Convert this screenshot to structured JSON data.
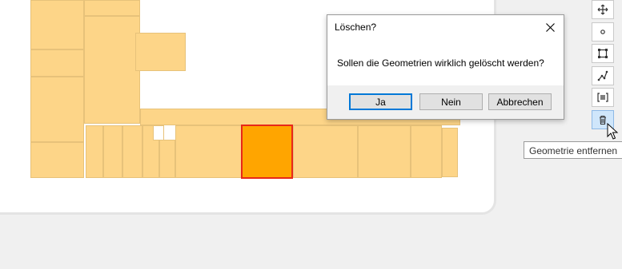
{
  "dialog": {
    "title": "Löschen?",
    "message": "Sollen die Geometrien wirklich gelöscht werden?",
    "buttons": {
      "yes": "Ja",
      "no": "Nein",
      "cancel": "Abbrechen"
    }
  },
  "toolbar": {
    "tools": [
      {
        "icon": "move-icon"
      },
      {
        "icon": "point-icon"
      },
      {
        "icon": "rectangle-edit-icon"
      },
      {
        "icon": "polyline-icon"
      },
      {
        "icon": "text-box-icon"
      },
      {
        "icon": "trash-icon",
        "active": true
      }
    ]
  },
  "tooltip": {
    "text": "Geometrie entfernen"
  },
  "colors": {
    "room_fill": "#fdd588",
    "selected_fill": "#ffa500",
    "selected_border": "#e8271a",
    "accent": "#0078d7"
  }
}
